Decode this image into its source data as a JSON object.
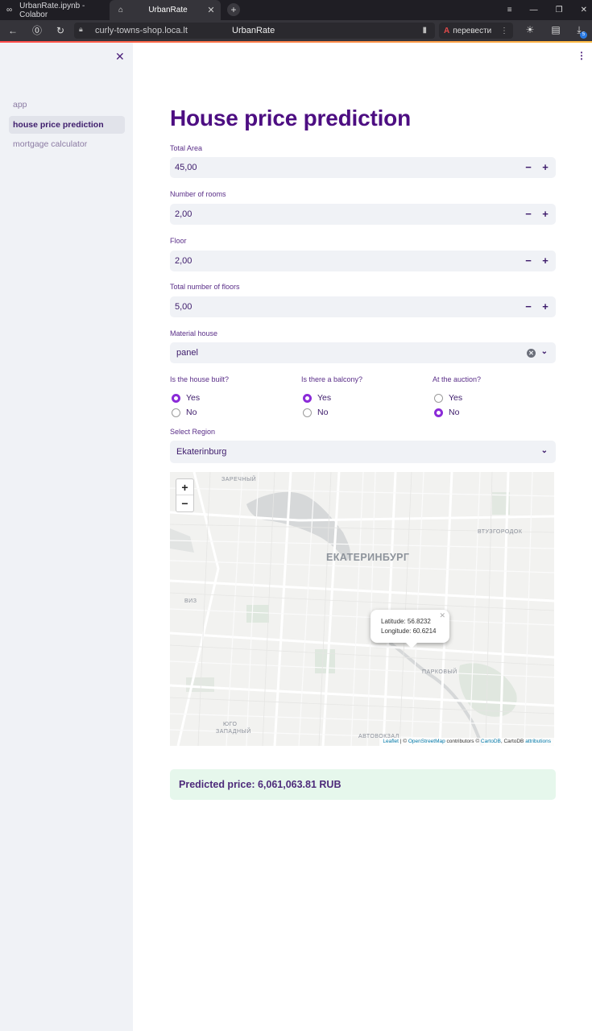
{
  "browser": {
    "tabs": [
      {
        "title": "UrbanRate.ipynb - Colabor",
        "icon": "colab-icon"
      },
      {
        "title": "UrbanRate",
        "icon": "home-icon",
        "active": true
      }
    ],
    "url": "curly-towns-shop.loca.lt",
    "page_title": "UrbanRate",
    "translate_label": "перевести",
    "download_badge": "5"
  },
  "sidebar": {
    "items": [
      {
        "label": "app"
      },
      {
        "label": "house price prediction",
        "active": true
      },
      {
        "label": "mortgage calculator"
      }
    ]
  },
  "main": {
    "title": "House price prediction",
    "fields": [
      {
        "label": "Total Area",
        "value": "45,00"
      },
      {
        "label": "Number of rooms",
        "value": "2,00"
      },
      {
        "label": "Floor",
        "value": "2,00"
      },
      {
        "label": "Total number of floors",
        "value": "5,00"
      }
    ],
    "material": {
      "label": "Material house",
      "value": "panel"
    },
    "radios": [
      {
        "label": "Is the house built?",
        "options": [
          "Yes",
          "No"
        ],
        "selected": "Yes"
      },
      {
        "label": "Is there a balcony?",
        "options": [
          "Yes",
          "No"
        ],
        "selected": "Yes"
      },
      {
        "label": "At the auction?",
        "options": [
          "Yes",
          "No"
        ],
        "selected": "No"
      }
    ],
    "region": {
      "label": "Select Region",
      "value": "Ekaterinburg"
    },
    "map": {
      "zoom_in": "+",
      "zoom_out": "−",
      "labels": {
        "city": "ЕКАТЕРИНБУРГ",
        "zarechny": "ЗАРЕЧНЫЙ",
        "vtuzgorodok": "ВТУЗГОРОДОК",
        "viz": "ВИЗ",
        "parkovy": "ПАРКОВЫЙ",
        "yugo1": "ЮГО",
        "yugo2": "ЗАПАДНЫЙ",
        "avtovokzal": "АВТОВОКЗАЛ"
      },
      "popup": {
        "lat": "Latitude: 56.8232",
        "lon": "Longitude: 60.6214"
      },
      "attribution": {
        "leaflet": "Leaflet",
        "sep": " | © ",
        "osm": "OpenStreetMap",
        "contrib": " contributors © ",
        "carto": "CartoDB",
        "carto2": ", CartoDB ",
        "attr": "attributions"
      }
    },
    "result": "Predicted price: 6,061,063.81 RUB"
  }
}
